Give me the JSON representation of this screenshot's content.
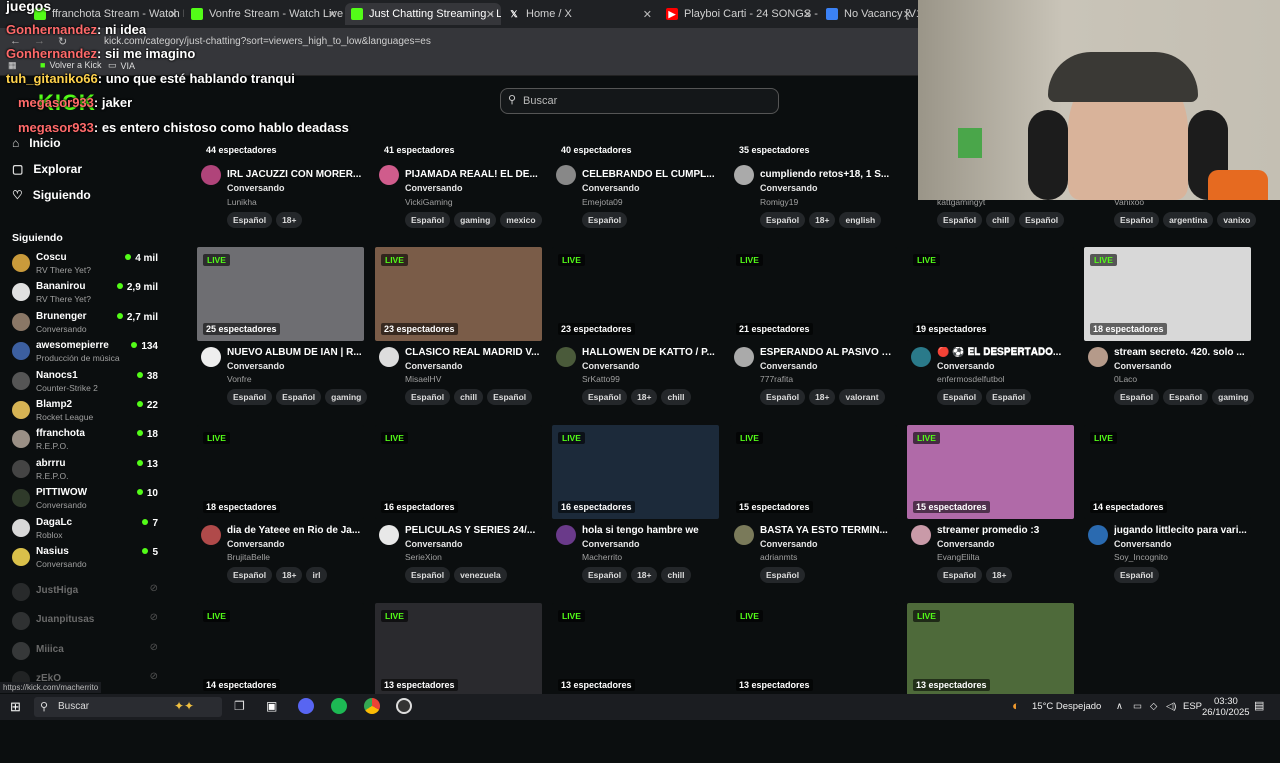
{
  "browser": {
    "tabs": [
      {
        "label": "ffranchota Stream - Watch Live",
        "icon": "kick"
      },
      {
        "label": "Vonfre Stream - Watch Live on",
        "icon": "kick"
      },
      {
        "label": "Just Chatting Streaming - Live",
        "icon": "kick",
        "active": true
      },
      {
        "label": "Home / X",
        "icon": "x"
      },
      {
        "label": "Playboi Carti - 24 SONGS - You",
        "icon": "youtube"
      },
      {
        "label": "No Vacancy [V1]",
        "icon": "page"
      }
    ],
    "url": "kick.com/category/just-chatting?sort=viewers_high_to_low&languages=es",
    "bookmarks": [
      "Volver a Kick",
      "VIA"
    ]
  },
  "overlay_title": "juegos",
  "chat": [
    {
      "user": "Gonhernandez",
      "text": ": ni idea"
    },
    {
      "user": "Gonhernandez",
      "text": ": sii me imagino"
    },
    {
      "user": "tuh_gitaniko66",
      "text": ": uno que esté hablando tranqui"
    },
    {
      "user": "megasor933",
      "text": ": jaker"
    },
    {
      "user": "megasor933",
      "text": ": es entero chistoso como hablo deadass"
    }
  ],
  "header": {
    "logo": "KICK",
    "search_placeholder": "Buscar"
  },
  "nav": [
    {
      "label": "Inicio",
      "icon": "home-icon"
    },
    {
      "label": "Explorar",
      "icon": "compass-icon"
    },
    {
      "label": "Siguiendo",
      "icon": "heart-icon"
    }
  ],
  "following_title": "Siguiendo",
  "following": [
    {
      "name": "Coscu",
      "category": "RV There Yet?",
      "viewers": "4 mil",
      "color": "#c99a3b"
    },
    {
      "name": "Bananirou",
      "category": "RV There Yet?",
      "viewers": "2,9 mil",
      "color": "#e0e0e0"
    },
    {
      "name": "Brunenger",
      "category": "Conversando",
      "viewers": "2,7 mil",
      "color": "#8a7766"
    },
    {
      "name": "awesomepierre",
      "category": "Producción de música",
      "viewers": "134",
      "color": "#3c5fa0"
    },
    {
      "name": "Nanocs1",
      "category": "Counter-Strike 2",
      "viewers": "38",
      "color": "#555"
    },
    {
      "name": "Blamp2",
      "category": "Rocket League",
      "viewers": "22",
      "color": "#d6b354"
    },
    {
      "name": "ffranchota",
      "category": "R.E.P.O.",
      "viewers": "18",
      "color": "#9a8f85"
    },
    {
      "name": "abrrru",
      "category": "R.E.P.O.",
      "viewers": "13",
      "color": "#444"
    },
    {
      "name": "PITTIWOW",
      "category": "Conversando",
      "viewers": "10",
      "color": "#2f3a2a"
    },
    {
      "name": "DagaLc",
      "category": "Roblox",
      "viewers": "7",
      "color": "#d8d8d8"
    },
    {
      "name": "Nasius",
      "category": "Conversando",
      "viewers": "5",
      "color": "#d9c04a"
    }
  ],
  "offline": [
    {
      "name": "JustHiga",
      "color": "#555"
    },
    {
      "name": "Juanpitusas",
      "color": "#666"
    },
    {
      "name": "Miiica",
      "color": "#777"
    },
    {
      "name": "zEkO",
      "color": "#444"
    }
  ],
  "streams_row0": [
    {
      "viewers": "44 espectadores",
      "title": "IRL JACUZZI CON MORER...",
      "category": "Conversando",
      "user": "Lunikha",
      "tags": [
        "Español",
        "18+"
      ],
      "avatar": "#b0447a"
    },
    {
      "viewers": "41 espectadores",
      "title": "PIJAMADA REAAL! EL DE...",
      "category": "Conversando",
      "user": "VickiGaming",
      "tags": [
        "Español",
        "gaming",
        "mexico"
      ],
      "avatar": "#d05c8c"
    },
    {
      "viewers": "40 espectadores",
      "title": "CELEBRANDO EL CUMPL...",
      "category": "Conversando",
      "user": "Emejota09",
      "tags": [
        "Español"
      ],
      "avatar": "#888"
    },
    {
      "viewers": "35 espectadores",
      "title": "cumpliendo retos+18, 1 S...",
      "category": "Conversando",
      "user": "Romigy19",
      "tags": [
        "Español",
        "18+",
        "english"
      ],
      "avatar": "#aaa"
    },
    {
      "viewers": "",
      "title": "",
      "category": "",
      "user": "kattgamingyt",
      "tags": [
        "Español",
        "chill",
        "Español"
      ],
      "avatar": "#999"
    },
    {
      "viewers": "",
      "title": "",
      "category": "",
      "user": "Vanixoo",
      "tags": [
        "Español",
        "argentina",
        "vanixo"
      ],
      "avatar": "#999"
    }
  ],
  "streams": [
    {
      "viewers": "25 espectadores",
      "title": "NUEVO ALBUM DE IAN | R...",
      "category": "Conversando",
      "user": "Vonfre",
      "tags": [
        "Español",
        "Español",
        "gaming"
      ],
      "avatar": "#eee",
      "thumb": "#6e6e72"
    },
    {
      "viewers": "23 espectadores",
      "title": "CLÁSICO REAL MADRID V...",
      "category": "Conversando",
      "user": "MisaelHV",
      "tags": [
        "Español",
        "chill",
        "Español"
      ],
      "avatar": "#ddd",
      "thumb": "#7a5c48"
    },
    {
      "viewers": "23 espectadores",
      "title": "HALLOWEN DE KATTO / P...",
      "category": "Conversando",
      "user": "SrKatto99",
      "tags": [
        "Español",
        "18+",
        "chill"
      ],
      "avatar": "#4a5a3a",
      "thumb": ""
    },
    {
      "viewers": "21 espectadores",
      "title": "ESPERANDO AL PASIVO D...",
      "category": "Conversando",
      "user": "777rafita",
      "tags": [
        "Español",
        "18+",
        "valorant"
      ],
      "avatar": "#aaa",
      "thumb": ""
    },
    {
      "viewers": "19 espectadores",
      "title": "🔴 ⚽ 𝐄𝐋 𝐃𝐄𝐒𝐏𝐄𝐑𝐓𝐀𝐃𝐎...",
      "category": "Conversando",
      "user": "enfermosdelfutbol",
      "tags": [
        "Español",
        "Español"
      ],
      "avatar": "#2a7a8a",
      "thumb": ""
    },
    {
      "viewers": "18 espectadores",
      "title": "stream secreto. 420. solo ...",
      "category": "Conversando",
      "user": "0Laco",
      "tags": [
        "Español",
        "Español",
        "gaming"
      ],
      "avatar": "#b59a8a",
      "thumb": "#d8d8d8"
    },
    {
      "viewers": "18 espectadores",
      "title": "dia de Yateee en Rio de Ja...",
      "category": "Conversando",
      "user": "BrujitaBelle",
      "tags": [
        "Español",
        "18+",
        "irl"
      ],
      "avatar": "#b04a4a",
      "thumb": ""
    },
    {
      "viewers": "16 espectadores",
      "title": "PELICULAS Y SERIES 24/...",
      "category": "Conversando",
      "user": "SerieXion",
      "tags": [
        "Español",
        "venezuela"
      ],
      "avatar": "#e8e8e8",
      "thumb": ""
    },
    {
      "viewers": "16 espectadores",
      "title": "hola si tengo hambre we",
      "category": "Conversando",
      "user": "Macherrito",
      "tags": [
        "Español",
        "18+",
        "chill"
      ],
      "avatar": "#6a3a8a",
      "thumb": "#1c2a3a"
    },
    {
      "viewers": "15 espectadores",
      "title": "BASTA YA ESTO TERMIN...",
      "category": "Conversando",
      "user": "adrianmts",
      "tags": [
        "Español"
      ],
      "avatar": "#7a7a5a",
      "thumb": ""
    },
    {
      "viewers": "15 espectadores",
      "title": "streamer promedio :3",
      "category": "Conversando",
      "user": "EvangElilta",
      "tags": [
        "Español",
        "18+"
      ],
      "avatar": "#c99aa8",
      "thumb": "#b06aa8"
    },
    {
      "viewers": "14 espectadores",
      "title": "jugando littlecito para vari...",
      "category": "Conversando",
      "user": "Soy_Incognito",
      "tags": [
        "Español"
      ],
      "avatar": "#2a6ab0",
      "thumb": ""
    },
    {
      "viewers": "14 espectadores",
      "title": "",
      "category": "",
      "user": "",
      "tags": [],
      "avatar": "",
      "thumb": ""
    },
    {
      "viewers": "13 espectadores",
      "title": "",
      "category": "",
      "user": "",
      "tags": [],
      "avatar": "",
      "thumb": "#2a2a2e"
    },
    {
      "viewers": "13 espectadores",
      "title": "",
      "category": "",
      "user": "",
      "tags": [],
      "avatar": "",
      "thumb": ""
    },
    {
      "viewers": "13 espectadores",
      "title": "",
      "category": "",
      "user": "",
      "tags": [],
      "avatar": "",
      "thumb": ""
    },
    {
      "viewers": "13 espectadores",
      "title": "",
      "category": "",
      "user": "",
      "tags": [],
      "avatar": "",
      "thumb": "#4e6a3a"
    }
  ],
  "live_label": "LIVE",
  "status_url": "https://kick.com/macherrito",
  "taskbar": {
    "search_label": "Buscar",
    "weather": "15°C  Despejado",
    "lang": "ESP",
    "time": "03:30",
    "date": "26/10/2025"
  },
  "colors": {
    "kick_green": "#53fc18",
    "chat_user": "#ff6a6a"
  }
}
